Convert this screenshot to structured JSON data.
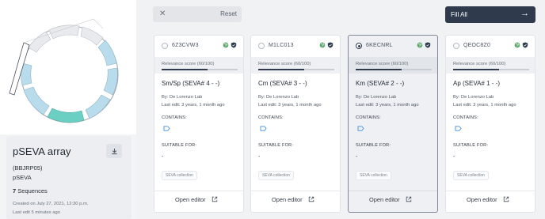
{
  "left_panel": {
    "title": "pSEVA array",
    "id": "(BBJRP05)",
    "subtitle": "pSEVA",
    "sequence_count": "7",
    "sequence_label": "Sequences",
    "created": "Created on July 27, 2021, 12:30 p.m.",
    "last_edit": "Last edit 5 minutes ago",
    "download_icon": "download-icon"
  },
  "toolbar": {
    "reset_label": "Reset",
    "close_icon": "close-icon",
    "fill_all_label": "Fill All",
    "arrow_icon": "arrow-right-icon"
  },
  "cards": [
    {
      "id": "6Z3CVW3",
      "selected": false,
      "score_label": "Relevance score (60/100)",
      "score": 0.6,
      "name": "Sm/Sp (SEVA# 4 - -)",
      "by": "By: De Lorenzo Lab",
      "last_edit": "Last edit: 3 years, 1 month ago",
      "contains_label": "CONTAINS:",
      "suitable_label": "SUITABLE FOR:",
      "suitable_value": "-",
      "tag": "SEVA collection",
      "open_label": "Open editor"
    },
    {
      "id": "M1LC013",
      "selected": false,
      "score_label": "Relevance score (60/100)",
      "score": 0.6,
      "name": "Cm (SEVA# 3 - -)",
      "by": "By: De Lorenzo Lab",
      "last_edit": "Last edit: 3 years, 1 month ago",
      "contains_label": "CONTAINS:",
      "suitable_label": "SUITABLE FOR:",
      "suitable_value": "-",
      "tag": "SEVA collection",
      "open_label": "Open editor"
    },
    {
      "id": "6KECNRL",
      "selected": true,
      "score_label": "Relevance score (60/100)",
      "score": 0.6,
      "name": "Km (SEVA# 2 - -)",
      "by": "By: De Lorenzo Lab",
      "last_edit": "Last edit: 3 years, 1 month ago",
      "contains_label": "CONTAINS:",
      "suitable_label": "SUITABLE FOR:",
      "suitable_value": "-",
      "tag": "SEVA collection",
      "open_label": "Open editor"
    },
    {
      "id": "QEOC8Z0",
      "selected": false,
      "score_label": "Relevance score (60/100)",
      "score": 0.6,
      "name": "Ap (SEVA# 1 - -)",
      "by": "By: De Lorenzo Lab",
      "last_edit": "Last edit: 3 years, 1 month ago",
      "contains_label": "CONTAINS:",
      "suitable_label": "SUITABLE FOR:",
      "suitable_value": "-",
      "tag": "SEVA collection",
      "open_label": "Open editor"
    }
  ],
  "colors": {
    "primary_dark": "#2f3b4c",
    "plasmid_blue": "#b9dced",
    "plasmid_teal": "#6ccfc4",
    "globe_green": "#5aa56a"
  }
}
